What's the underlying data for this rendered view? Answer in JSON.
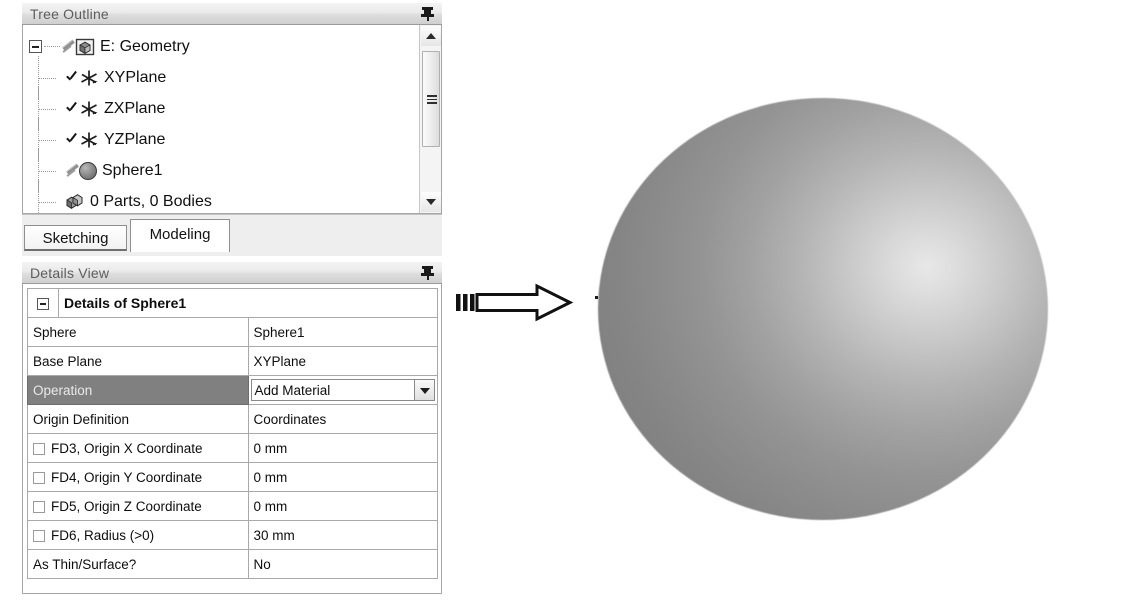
{
  "tree_panel": {
    "title": "Tree Outline",
    "pin_icon": "pin-icon",
    "root": {
      "label": "E: Geometry",
      "icon": "geometry-cube-icon",
      "state_icon": "pencil-icon",
      "expander": "collapse-minus-icon"
    },
    "items": [
      {
        "label": "XYPlane",
        "icon": "plane-axes-icon",
        "state_icon": "check-icon"
      },
      {
        "label": "ZXPlane",
        "icon": "plane-axes-icon",
        "state_icon": "check-icon"
      },
      {
        "label": "YZPlane",
        "icon": "plane-axes-icon",
        "state_icon": "check-icon"
      },
      {
        "label": "Sphere1",
        "icon": "sphere-icon",
        "state_icon": "pencil-icon"
      },
      {
        "label": "0 Parts, 0 Bodies",
        "icon": "bodies-cube-icon",
        "state_icon": ""
      }
    ],
    "scrollbar": {
      "up_icon": "scroll-up-arrow-icon",
      "down_icon": "scroll-down-arrow-icon",
      "thumb": "scroll-thumb"
    },
    "tabs": [
      {
        "label": "Sketching",
        "active": false
      },
      {
        "label": "Modeling",
        "active": true
      }
    ]
  },
  "details_panel": {
    "title": "Details View",
    "pin_icon": "pin-icon",
    "group_title": "Details of Sphere1",
    "group_expander": "collapse-minus-icon",
    "rows": [
      {
        "property": "Sphere",
        "value": "Sphere1",
        "checkbox": false,
        "highlight": false,
        "dropdown": false
      },
      {
        "property": "Base Plane",
        "value": "XYPlane",
        "checkbox": false,
        "highlight": false,
        "dropdown": false
      },
      {
        "property": "Operation",
        "value": "Add Material",
        "checkbox": false,
        "highlight": true,
        "dropdown": true
      },
      {
        "property": "Origin Definition",
        "value": "Coordinates",
        "checkbox": false,
        "highlight": false,
        "dropdown": false
      },
      {
        "property": "FD3, Origin X Coordinate",
        "value": "0 mm",
        "checkbox": true,
        "highlight": false,
        "dropdown": false
      },
      {
        "property": "FD4, Origin Y Coordinate",
        "value": "0 mm",
        "checkbox": true,
        "highlight": false,
        "dropdown": false
      },
      {
        "property": "FD5, Origin Z Coordinate",
        "value": "0 mm",
        "checkbox": true,
        "highlight": false,
        "dropdown": false
      },
      {
        "property": "FD6, Radius (>0)",
        "value": "30 mm",
        "checkbox": true,
        "highlight": false,
        "dropdown": false
      },
      {
        "property": "As Thin/Surface?",
        "value": "No",
        "checkbox": false,
        "highlight": false,
        "dropdown": false
      }
    ]
  },
  "flow_arrow": {
    "icon": "right-arrow-icon"
  },
  "viewport": {
    "model_icon": "shaded-sphere-3d",
    "colors": {
      "highlight": "#e8e8e8",
      "midtone": "#a2a2a2",
      "shadow": "#818181"
    }
  }
}
